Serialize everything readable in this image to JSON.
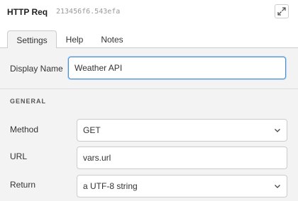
{
  "header": {
    "node_type": "HTTP Req",
    "node_id": "213456f6.543efa"
  },
  "tabs": [
    {
      "label": "Settings",
      "active": true
    },
    {
      "label": "Help",
      "active": false
    },
    {
      "label": "Notes",
      "active": false
    }
  ],
  "form": {
    "display_name": {
      "label": "Display Name",
      "value": "Weather API"
    },
    "section_title": "GENERAL",
    "method": {
      "label": "Method",
      "value": "GET"
    },
    "url": {
      "label": "URL",
      "value": "vars.url"
    },
    "return": {
      "label": "Return",
      "value": "a UTF-8 string"
    }
  },
  "colors": {
    "focus": "#4a90d9",
    "border": "#cccccc"
  },
  "icons": {
    "expand": "expand-icon",
    "chevron": "chevron-down-icon"
  }
}
